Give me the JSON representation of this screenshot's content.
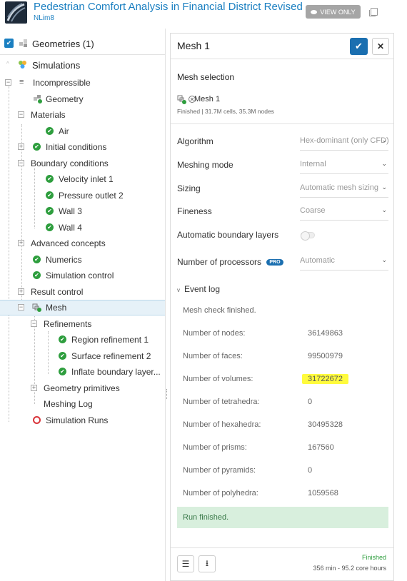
{
  "header": {
    "title": "Pedestrian Comfort Analysis in Financial District Revised",
    "owner": "NLim8",
    "view_only": "VIEW ONLY"
  },
  "tree": {
    "geometries": "Geometries (1)",
    "simulations": "Simulations",
    "incompressible": "Incompressible",
    "geometry": "Geometry",
    "materials": "Materials",
    "air": "Air",
    "initial_conditions": "Initial conditions",
    "boundary_conditions": "Boundary conditions",
    "velocity_inlet": "Velocity inlet 1",
    "pressure_outlet": "Pressure outlet 2",
    "wall3": "Wall 3",
    "wall4": "Wall 4",
    "advanced_concepts": "Advanced concepts",
    "numerics": "Numerics",
    "simulation_control": "Simulation control",
    "result_control": "Result control",
    "mesh": "Mesh",
    "refinements": "Refinements",
    "region_refinement": "Region refinement 1",
    "surface_refinement": "Surface refinement 2",
    "inflate_boundary": "Inflate boundary layer...",
    "geometry_primitives": "Geometry primitives",
    "meshing_log": "Meshing Log",
    "simulation_runs": "Simulation Runs"
  },
  "panel": {
    "title": "Mesh 1",
    "mesh_selection_label": "Mesh selection",
    "mesh_name": "Mesh 1",
    "mesh_info": "Finished | 31.7M cells, 35.3M nodes",
    "fields": {
      "algorithm_label": "Algorithm",
      "algorithm_value": "Hex-dominant (only CFD)",
      "meshing_mode_label": "Meshing mode",
      "meshing_mode_value": "Internal",
      "sizing_label": "Sizing",
      "sizing_value": "Automatic mesh sizing",
      "fineness_label": "Fineness",
      "fineness_value": "Coarse",
      "auto_boundary_label": "Automatic boundary layers",
      "processors_label": "Number of processors",
      "pro_badge": "PRO",
      "processors_value": "Automatic"
    },
    "event_log": {
      "title": "Event log",
      "message": "Mesh check finished.",
      "rows": [
        {
          "label": "Number of nodes:",
          "value": "36149863"
        },
        {
          "label": "Number of faces:",
          "value": "99500979"
        },
        {
          "label": "Number of volumes:",
          "value": "31722672"
        },
        {
          "label": "Number of tetrahedra:",
          "value": "0"
        },
        {
          "label": "Number of hexahedra:",
          "value": "30495328"
        },
        {
          "label": "Number of prisms:",
          "value": "167560"
        },
        {
          "label": "Number of pyramids:",
          "value": "0"
        },
        {
          "label": "Number of polyhedra:",
          "value": "1059568"
        }
      ],
      "run_finished": "Run finished."
    },
    "footer": {
      "status": "Finished",
      "time": "356 min - 95.2 core hours"
    }
  },
  "icons": {
    "check": "✔",
    "close": "✕",
    "chevron": "⌄",
    "list": "☰",
    "download": "⭳"
  },
  "colors": {
    "accent": "#1a7fc1",
    "success": "#2e9e3e",
    "error": "#d9343a",
    "highlight": "#fffb3d"
  }
}
